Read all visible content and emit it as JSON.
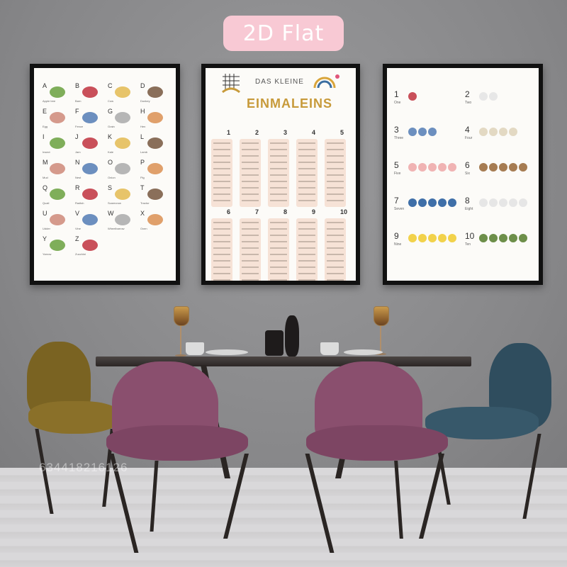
{
  "badge": {
    "label": "2D Flat"
  },
  "poster_abc": {
    "letters": [
      {
        "ch": "A",
        "word": "Apple tree"
      },
      {
        "ch": "B",
        "word": "Barn"
      },
      {
        "ch": "C",
        "word": "Cow"
      },
      {
        "ch": "D",
        "word": "Donkey"
      },
      {
        "ch": "E",
        "word": "Egg"
      },
      {
        "ch": "F",
        "word": "Fence"
      },
      {
        "ch": "G",
        "word": "Grain"
      },
      {
        "ch": "H",
        "word": "Hen"
      },
      {
        "ch": "I",
        "word": "Insect"
      },
      {
        "ch": "J",
        "word": "Jam"
      },
      {
        "ch": "K",
        "word": "Kale"
      },
      {
        "ch": "L",
        "word": "Lamb"
      },
      {
        "ch": "M",
        "word": "Mud"
      },
      {
        "ch": "N",
        "word": "Nest"
      },
      {
        "ch": "O",
        "word": "Onion"
      },
      {
        "ch": "P",
        "word": "Pig"
      },
      {
        "ch": "Q",
        "word": "Quail"
      },
      {
        "ch": "R",
        "word": "Radish"
      },
      {
        "ch": "S",
        "word": "Scarecrow"
      },
      {
        "ch": "T",
        "word": "Tractor"
      },
      {
        "ch": "U",
        "word": "Udder"
      },
      {
        "ch": "V",
        "word": "Vine"
      },
      {
        "ch": "W",
        "word": "Wheelbarrow"
      },
      {
        "ch": "X",
        "word": "Oxen"
      },
      {
        "ch": "Y",
        "word": "Yarrow"
      },
      {
        "ch": "Z",
        "word": "Zucchini"
      }
    ]
  },
  "poster_times": {
    "title_small": "DAS KLEINE",
    "title_big": "EINMALEINS",
    "tables": [
      "1",
      "2",
      "3",
      "4",
      "5",
      "6",
      "7",
      "8",
      "9",
      "10"
    ]
  },
  "poster_count": {
    "items": [
      {
        "num": "1",
        "word": "One"
      },
      {
        "num": "2",
        "word": "Two"
      },
      {
        "num": "3",
        "word": "Three"
      },
      {
        "num": "4",
        "word": "Four"
      },
      {
        "num": "5",
        "word": "Five"
      },
      {
        "num": "6",
        "word": "Six"
      },
      {
        "num": "7",
        "word": "Seven"
      },
      {
        "num": "8",
        "word": "Eight"
      },
      {
        "num": "9",
        "word": "Nine"
      },
      {
        "num": "10",
        "word": "Ten"
      }
    ]
  },
  "watermark": {
    "text": "634418216126"
  },
  "colors": {
    "badge": "#f8c9d4",
    "chair_pink": "#8a4f6e",
    "chair_yellow": "#7a6322",
    "chair_teal": "#2f4d5e",
    "table": "#2c2726"
  }
}
